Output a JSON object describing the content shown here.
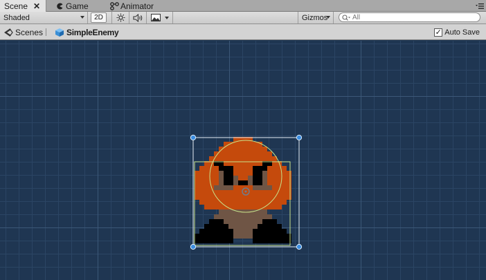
{
  "tabs": {
    "scene": "Scene",
    "game": "Game",
    "animator": "Animator"
  },
  "toolbar": {
    "shading_mode": "Shaded",
    "mode_2d": "2D",
    "lighting_icon": "sun-icon",
    "audio_icon": "speaker-icon",
    "effects_icon": "image-icon",
    "gizmos_label": "Gizmos",
    "search_placeholder": "All"
  },
  "breadcrumb": {
    "scenes_label": "Scenes",
    "prefab_name": "SimpleEnemy",
    "auto_save_label": "Auto Save",
    "auto_save_checked": true
  },
  "scene": {
    "background_color": "#1f3652",
    "grid_color": "#3a5675",
    "selected_object": "SimpleEnemy",
    "sprite_colors": {
      "body": "#c54a0c",
      "shadow": "#6f5545",
      "feet": "#000000",
      "collider": "#c8e28a",
      "handles": "#3b8de0"
    }
  }
}
